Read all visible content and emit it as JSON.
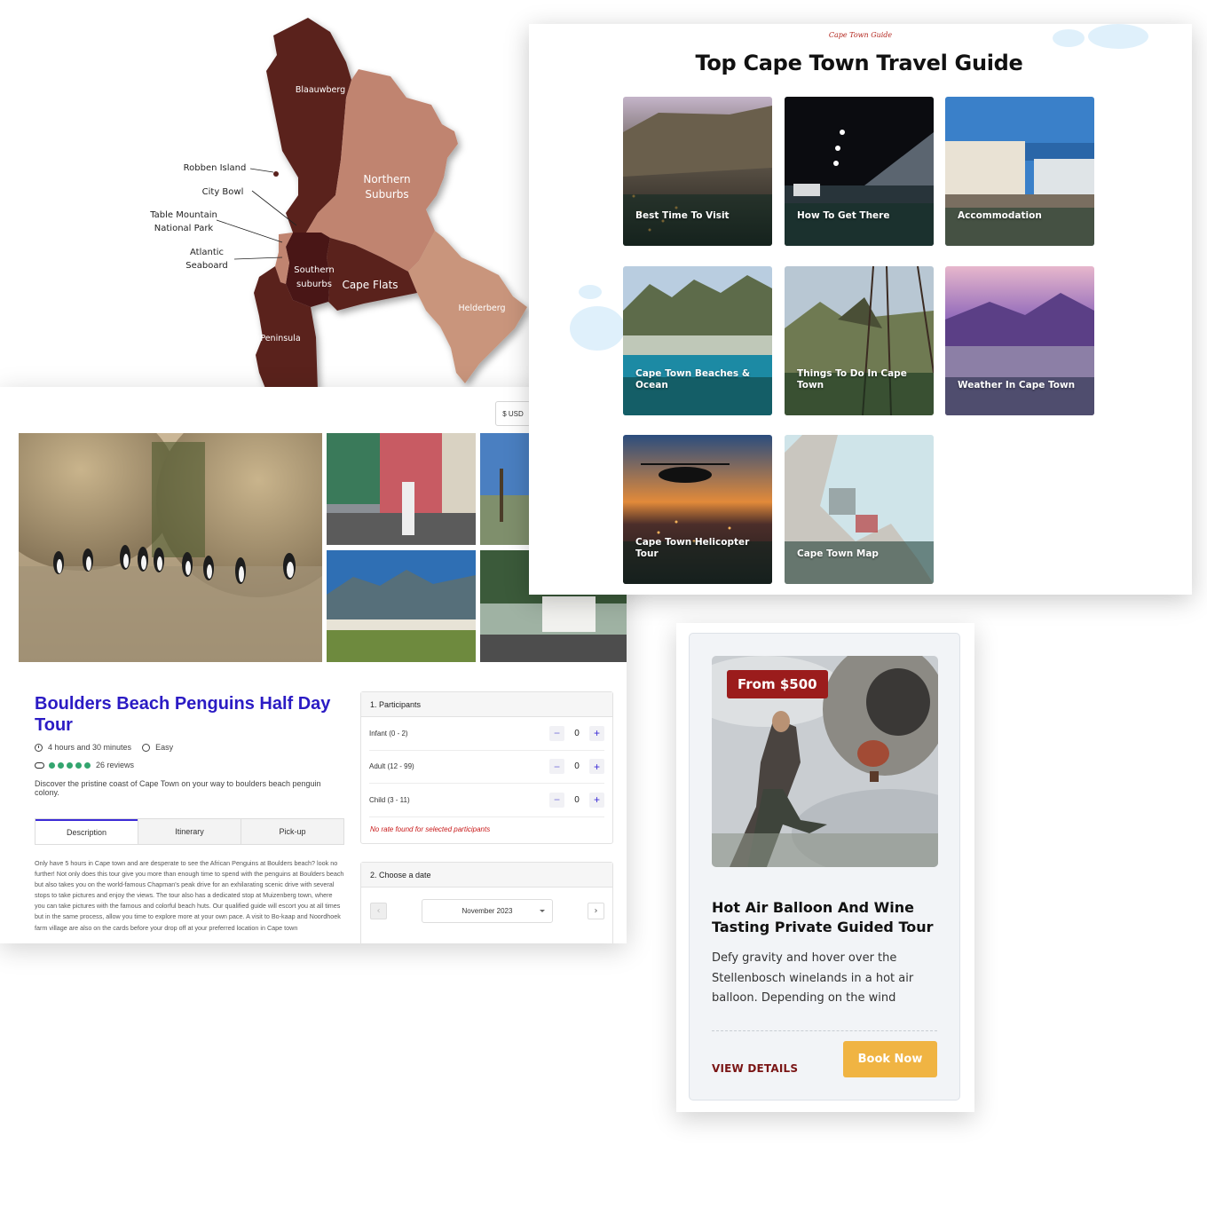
{
  "map": {
    "regions": {
      "blaauwberg": "Blaauwberg",
      "northern_suburbs_1": "Northern",
      "northern_suburbs_2": "Suburbs",
      "southern_suburbs_1": "Southern",
      "southern_suburbs_2": "suburbs",
      "cape_flats": "Cape Flats",
      "helderberg": "Helderberg",
      "peninsula": "Peninsula"
    },
    "callouts": {
      "robben_island": "Robben Island",
      "city_bowl": "City Bowl",
      "table_mountain_1": "Table Mountain",
      "table_mountain_2": "National Park",
      "atlantic_1": "Atlantic",
      "atlantic_2": "Seaboard"
    },
    "colors": {
      "dark": "#5a211d",
      "medium": "#b87a61",
      "light": "#cf9a80"
    }
  },
  "tour": {
    "currency": "$ USD",
    "title": "Boulders Beach Penguins Half Day Tour",
    "duration": "4 hours and 30 minutes",
    "difficulty": "Easy",
    "reviews": "26 reviews",
    "summary": "Discover the pristine coast of Cape Town on your way to boulders beach penguin colony.",
    "tabs": [
      "Description",
      "Itinerary",
      "Pick-up"
    ],
    "description": "Only have 5 hours in Cape town and are desperate to see the African Penguins at Boulders beach? look no further! Not only does this tour give you more than enough time to spend with the penguins at Boulders beach but also takes you on the world-famous Chapman's peak drive for an exhilarating scenic drive with several stops to take pictures and enjoy the views. The tour also has a dedicated stop at Muizenberg town, where you can take pictures with the famous and colorful beach huts. Our qualified guide will escort you at all times but in the same process, allow you time to explore more at your own pace. A visit to Bo-kaap and Noordhoek farm village are also on the cards before your drop off at your preferred location in Cape town",
    "participants": {
      "heading": "1. Participants",
      "rows": [
        {
          "label": "Infant (0 - 2)",
          "value": "0"
        },
        {
          "label": "Adult (12 - 99)",
          "value": "0"
        },
        {
          "label": "Child (3 - 11)",
          "value": "0"
        }
      ],
      "error": "No rate found for selected participants"
    },
    "date": {
      "heading": "2. Choose a date",
      "month": "November 2023"
    }
  },
  "guide": {
    "brand": "Cape Town Guide",
    "title": "Top Cape Town Travel Guide",
    "cards": [
      {
        "label": "Best Time To Visit"
      },
      {
        "label": "How To Get There"
      },
      {
        "label": "Accommodation"
      },
      {
        "label": "Cape Town Beaches & Ocean"
      },
      {
        "label": "Things To Do In Cape Town"
      },
      {
        "label": "Weather In Cape Town"
      },
      {
        "label": "Cape Town Helicopter Tour"
      },
      {
        "label": "Cape Town Map"
      }
    ]
  },
  "balloon": {
    "price": "From $500",
    "title": "Hot Air Balloon And Wine Tasting Private Guided Tour",
    "description": "Defy gravity and hover over the Stellenbosch winelands in a hot air balloon. Depending on the wind",
    "view_details": "VIEW DETAILS",
    "book_now": "Book Now",
    "colors": {
      "accent": "#9b1c1c",
      "button": "#f0b443"
    }
  }
}
